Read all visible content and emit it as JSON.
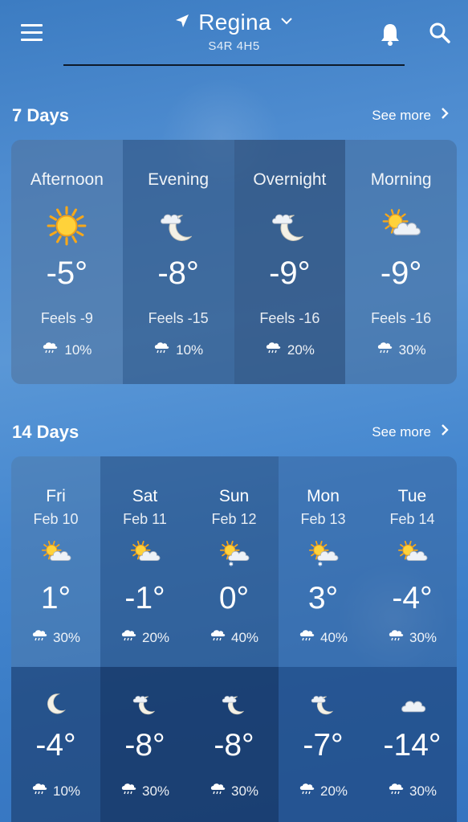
{
  "header": {
    "location": "Regina",
    "postal_code": "S4R 4H5"
  },
  "seven_days": {
    "title": "7 Days",
    "see_more": "See more",
    "periods": [
      {
        "name": "Afternoon",
        "icon": "sun-icon",
        "temp": "-5°",
        "feels": "Feels -9",
        "pop": "10%"
      },
      {
        "name": "Evening",
        "icon": "moon-cloud-icon",
        "temp": "-8°",
        "feels": "Feels -15",
        "pop": "10%"
      },
      {
        "name": "Overnight",
        "icon": "moon-cloud-icon",
        "temp": "-9°",
        "feels": "Feels -16",
        "pop": "20%"
      },
      {
        "name": "Morning",
        "icon": "sun-cloud-icon",
        "temp": "-9°",
        "feels": "Feels -16",
        "pop": "30%"
      }
    ]
  },
  "fourteen_days": {
    "title": "14 Days",
    "see_more": "See more",
    "days": [
      {
        "day": "Fri",
        "date": "Feb 10",
        "day_icon": "sun-cloud-icon",
        "day_temp": "1°",
        "day_pop": "30%",
        "night_icon": "moon-icon",
        "night_temp": "-4°",
        "night_pop": "10%"
      },
      {
        "day": "Sat",
        "date": "Feb 11",
        "day_icon": "sun-cloud-icon",
        "day_temp": "-1°",
        "day_pop": "20%",
        "night_icon": "moon-cloud-icon",
        "night_temp": "-8°",
        "night_pop": "30%"
      },
      {
        "day": "Sun",
        "date": "Feb 12",
        "day_icon": "sun-cloud-snow-icon",
        "day_temp": "0°",
        "day_pop": "40%",
        "night_icon": "moon-cloud-icon",
        "night_temp": "-8°",
        "night_pop": "30%"
      },
      {
        "day": "Mon",
        "date": "Feb 13",
        "day_icon": "sun-cloud-snow-icon",
        "day_temp": "3°",
        "day_pop": "40%",
        "night_icon": "moon-cloud-icon",
        "night_temp": "-7°",
        "night_pop": "20%"
      },
      {
        "day": "Tue",
        "date": "Feb 14",
        "day_icon": "sun-cloud-icon",
        "day_temp": "-4°",
        "day_pop": "30%",
        "night_icon": "cloud-icon",
        "night_temp": "-14°",
        "night_pop": "30%"
      }
    ]
  },
  "colors": {
    "background": "#4e8cd0",
    "sun": "#f7b21a",
    "text": "#ffffff"
  }
}
